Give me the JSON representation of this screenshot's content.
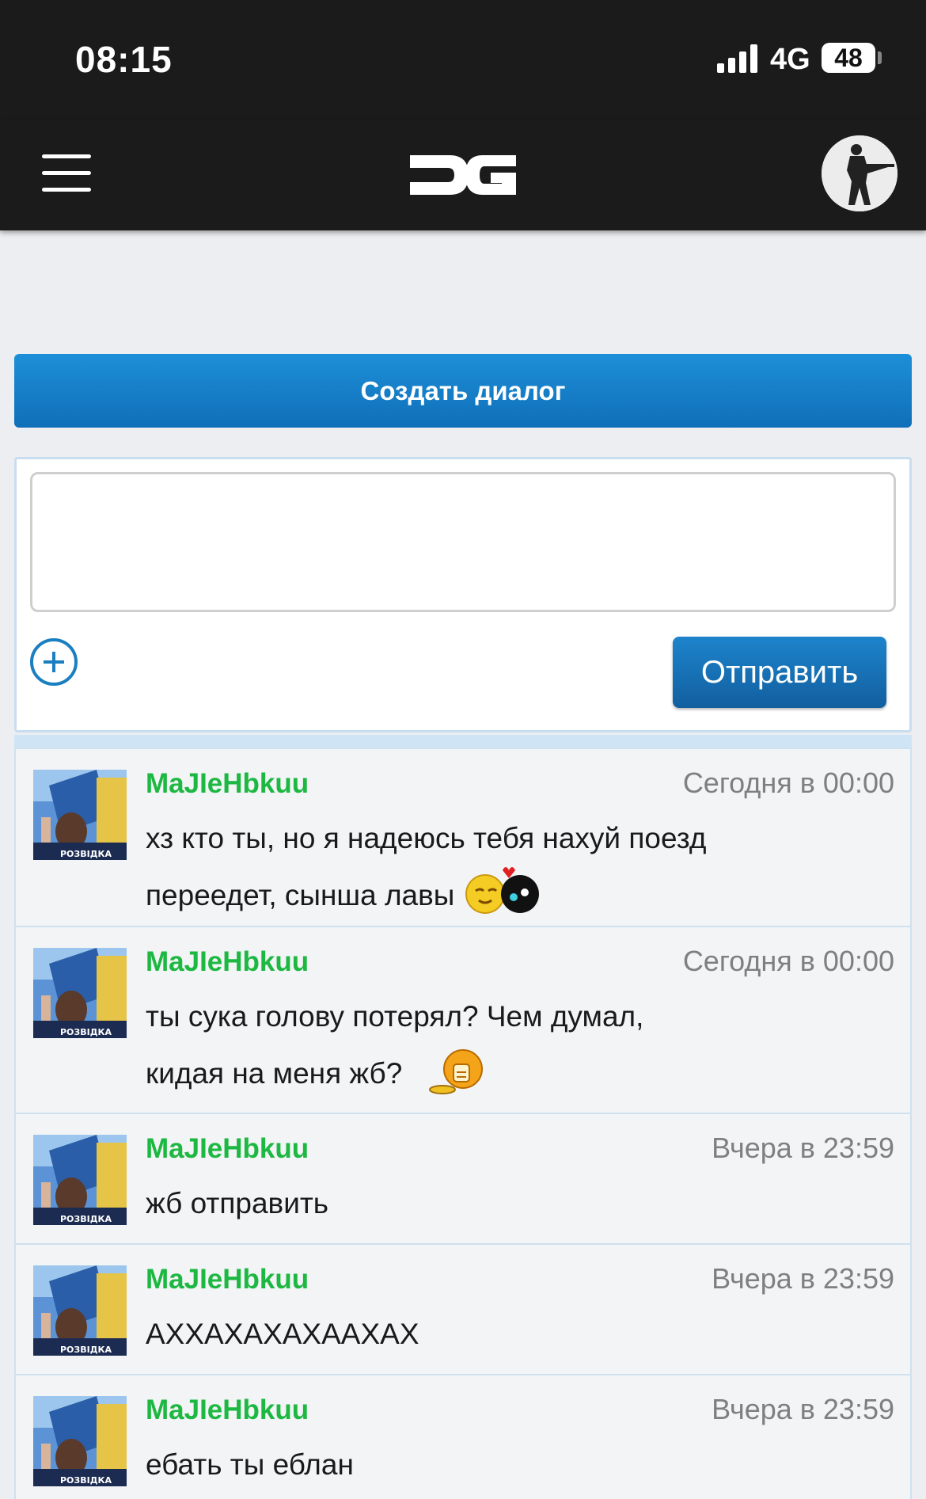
{
  "status_bar": {
    "time": "08:15",
    "network": "4G",
    "battery": "48"
  },
  "header": {
    "logo_text": "DG",
    "menu_icon": "hamburger-menu-icon",
    "avatar_icon": "soldier-avatar-icon"
  },
  "create_dialog_label": "Создать диалог",
  "composer": {
    "placeholder": "",
    "value": "",
    "attach_icon": "plus-circle-icon",
    "send_label": "Отправить"
  },
  "messages": [
    {
      "author": "MaJIeHbkuu",
      "time": "Сегодня в 00:00",
      "text": "хз кто ты, но я надеюсь тебя нахуй поезд переедет, сынша лавы",
      "smiley": "kiss-smiley-icon"
    },
    {
      "author": "MaJIeHbkuu",
      "time": "Сегодня в 00:00",
      "text": "ты сука голову потерял? Чем думал, кидая на меня жб?",
      "smiley": "headless-smiley-icon"
    },
    {
      "author": "MaJIeHbkuu",
      "time": "Вчера в 23:59",
      "text": "жб отправить"
    },
    {
      "author": "MaJIeHbkuu",
      "time": "Вчера в 23:59",
      "text": "АХХАХАХАХААХАХ"
    },
    {
      "author": "MaJIeHbkuu",
      "time": "Вчера в 23:59",
      "text": "ебать ты еблан"
    }
  ],
  "avatar_caption": "РОЗВІДКА",
  "colors": {
    "header_bg": "#1b1b1b",
    "accent_blue": "#1580c8",
    "author_green": "#1db841",
    "page_bg": "#eceef1"
  }
}
